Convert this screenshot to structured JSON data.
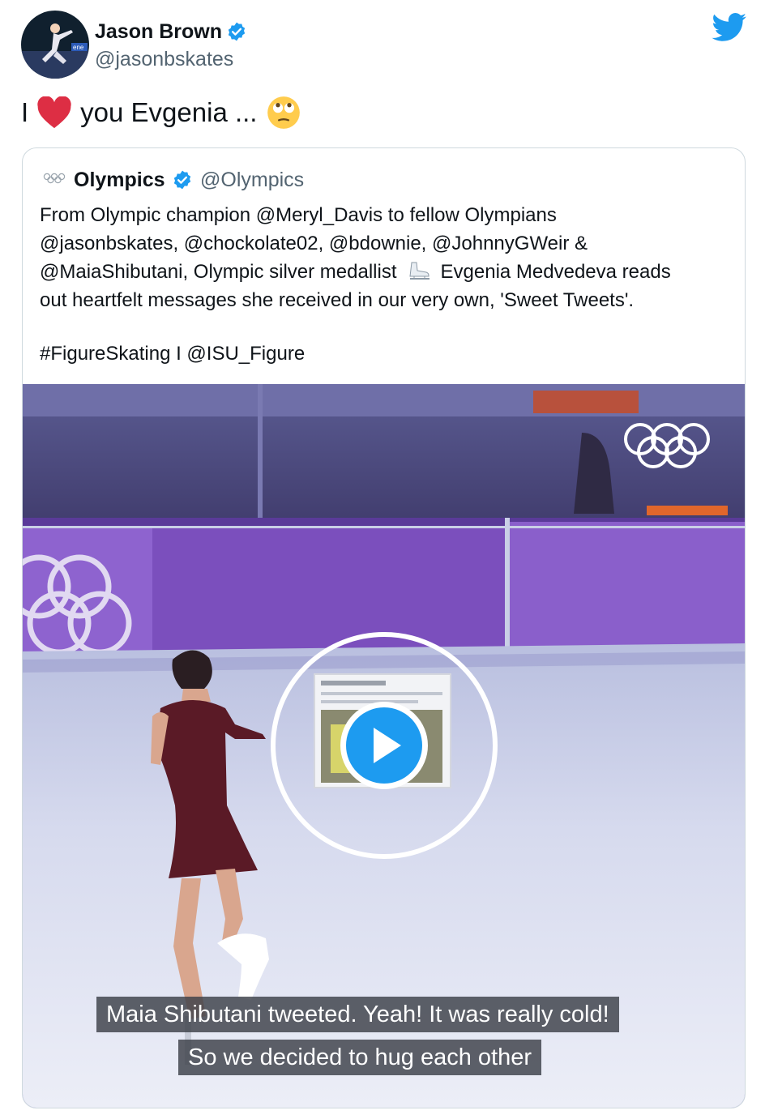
{
  "author": {
    "name": "Jason Brown",
    "handle": "@jasonbskates",
    "avatar_badge": "ene"
  },
  "tweet": {
    "text_before": "I",
    "text_after": "you Evgenia ...",
    "emojis": [
      "red-heart",
      "face-with-rolling-eyes"
    ]
  },
  "quoted": {
    "name": "Olympics",
    "handle": "@Olympics",
    "logo": "olympic-rings",
    "body_lines": [
      "From Olympic champion @Meryl_Davis to fellow Olympians",
      "@jasonbskates, @chockolate02, @bdownie, @JohnnyGWeir &",
      "@MaiaShibutani, Olympic silver medallist",
      "out heartfelt messages she received in our very own, 'Sweet Tweets'."
    ],
    "line3_after_emoji": "Evgenia Medvedeva reads",
    "line3_emoji": "ice-skate",
    "hashtags": "#FigureSkating I @ISU_Figure"
  },
  "video": {
    "captions": [
      "Maia Shibutani tweeted. Yeah! It was really cold!",
      "So we decided to hug each other"
    ],
    "play_icon": "play-icon"
  },
  "colors": {
    "twitter_blue": "#1d9bf0",
    "rink_purple": "#6e52b8",
    "ice": "#dfe3f2"
  }
}
